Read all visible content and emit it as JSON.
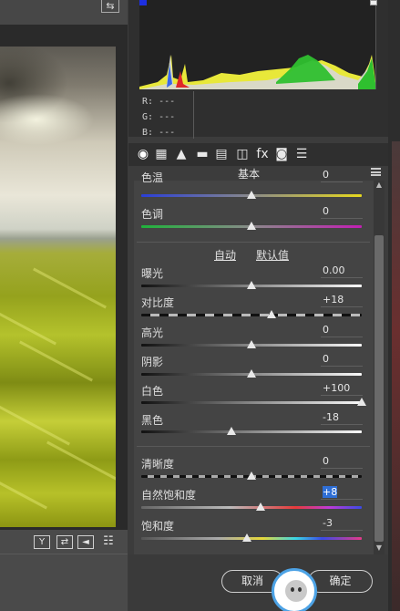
{
  "histogram": {
    "readout": [
      {
        "channel": "R:",
        "value": "---"
      },
      {
        "channel": "G:",
        "value": "---"
      },
      {
        "channel": "B:",
        "value": "---"
      }
    ]
  },
  "tools": [
    {
      "name": "basic-tab-icon",
      "glyph": "◉"
    },
    {
      "name": "tone-curve-icon",
      "glyph": "▦"
    },
    {
      "name": "detail-icon",
      "glyph": "▲"
    },
    {
      "name": "hsl-icon",
      "glyph": "▬"
    },
    {
      "name": "split-toning-icon",
      "glyph": "▤"
    },
    {
      "name": "lens-corrections-icon",
      "glyph": "◫"
    },
    {
      "name": "effects-icon",
      "glyph": "fx"
    },
    {
      "name": "camera-calibration-icon",
      "glyph": "◙"
    },
    {
      "name": "presets-icon",
      "glyph": "☰"
    }
  ],
  "panel": {
    "title": "基本",
    "auto_label": "自动",
    "default_label": "默认值"
  },
  "sliders": [
    {
      "id": "temp",
      "label": "色温",
      "value": "0",
      "level": 0.5
    },
    {
      "id": "tint",
      "label": "色调",
      "value": "0",
      "level": 0.5
    },
    {
      "id": "exposure",
      "label": "曝光",
      "value": "0.00",
      "level": 0.5
    },
    {
      "id": "contrast",
      "label": "对比度",
      "value": "+18",
      "level": 0.59
    },
    {
      "id": "highlights",
      "label": "高光",
      "value": "0",
      "level": 0.5
    },
    {
      "id": "shadows",
      "label": "阴影",
      "value": "0",
      "level": 0.5
    },
    {
      "id": "whites",
      "label": "白色",
      "value": "+100",
      "level": 1.0
    },
    {
      "id": "blacks",
      "label": "黑色",
      "value": "-18",
      "level": 0.41
    },
    {
      "id": "clarity",
      "label": "清晰度",
      "value": "0",
      "level": 0.5
    },
    {
      "id": "vibrance",
      "label": "自然饱和度",
      "value": "+8",
      "level": 0.54
    },
    {
      "id": "saturation",
      "label": "饱和度",
      "value": "-3",
      "level": 0.48
    }
  ],
  "footer": {
    "cancel_label": "取消",
    "ok_label": "确定"
  },
  "colors": {
    "selection": "#2f6fd6",
    "avatar_ring": "#4da3e6"
  }
}
